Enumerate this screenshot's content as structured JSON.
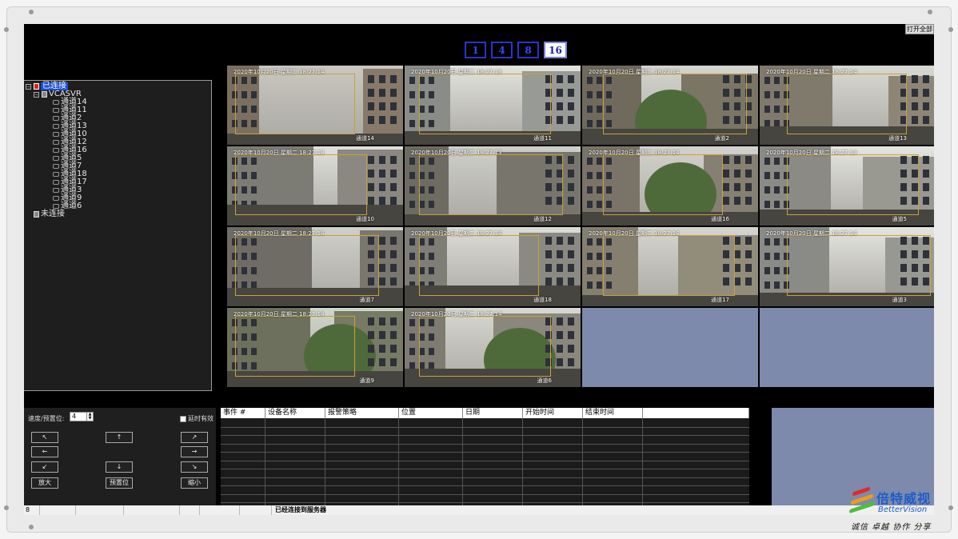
{
  "toolbar": {
    "open_all_label": "打开全部",
    "layouts": [
      "1",
      "4",
      "8",
      "16"
    ],
    "active_layout": "16"
  },
  "tree": {
    "connected_label": "已连接",
    "server_label": "VCASVR",
    "channels": [
      "通道14",
      "通道11",
      "通道2",
      "通道13",
      "通道10",
      "通道12",
      "通道16",
      "通道5",
      "通道7",
      "通道18",
      "通道17",
      "通道3",
      "通道9",
      "通道6"
    ],
    "disconnected_label": "未连接"
  },
  "videos": [
    {
      "timestamp": "2020年10月20日  星期二  18:27:14",
      "channel": "通道14"
    },
    {
      "timestamp": "2020年10月20日  星期二  18:27:13",
      "channel": "通道11"
    },
    {
      "timestamp": "2020年10月20日  星期二  18:27:14",
      "channel": "通道2"
    },
    {
      "timestamp": "2020年10月20日  星期二  18:27:14",
      "channel": "通道13"
    },
    {
      "timestamp": "2020年10月20日  星期二  18:27:13",
      "channel": "通道10"
    },
    {
      "timestamp": "2020年10月20日  星期二  18:27:13",
      "channel": "通道12"
    },
    {
      "timestamp": "2020年10月20日  星期二  18:27:14",
      "channel": "通道16"
    },
    {
      "timestamp": "2020年10月20日  星期二  18:27:14",
      "channel": "通道5"
    },
    {
      "timestamp": "2020年10月20日  星期二  18:27:14",
      "channel": "通道7"
    },
    {
      "timestamp": "2020年10月20日  星期二  18:27:14",
      "channel": "通道18"
    },
    {
      "timestamp": "2020年10月20日  星期二  18:27:14",
      "channel": "通道17"
    },
    {
      "timestamp": "2020年10月20日  星期二  18:27:14",
      "channel": "通道3"
    },
    {
      "timestamp": "2020年10月20日  星期二  18:27:14",
      "channel": "通道9"
    },
    {
      "timestamp": "2020年10月20日  星期二  18:27:14",
      "channel": "通道6"
    }
  ],
  "ptz": {
    "speed_label": "速度/预置位:",
    "speed_value": "4",
    "delay_label": "延时有效",
    "zoom_in": "放大",
    "preset": "预置位",
    "zoom_out": "缩小",
    "arrows": {
      "up_left": "↖",
      "up": "↑",
      "up_right": "↗",
      "left": "←",
      "right": "→",
      "down_left": "↙",
      "down": "↓",
      "down_right": "↘"
    }
  },
  "events": {
    "columns": [
      "事件 #",
      "设备名称",
      "报警策略",
      "位置",
      "日期",
      "开始时间",
      "结束时间",
      ""
    ]
  },
  "status_bar": {
    "first_cell": "8",
    "message": "已经连接到服务器"
  },
  "logo": {
    "name_cn": "倍特威视",
    "name_en": "BetterVision",
    "slogan": "诚信 卓越 协作 分享"
  }
}
